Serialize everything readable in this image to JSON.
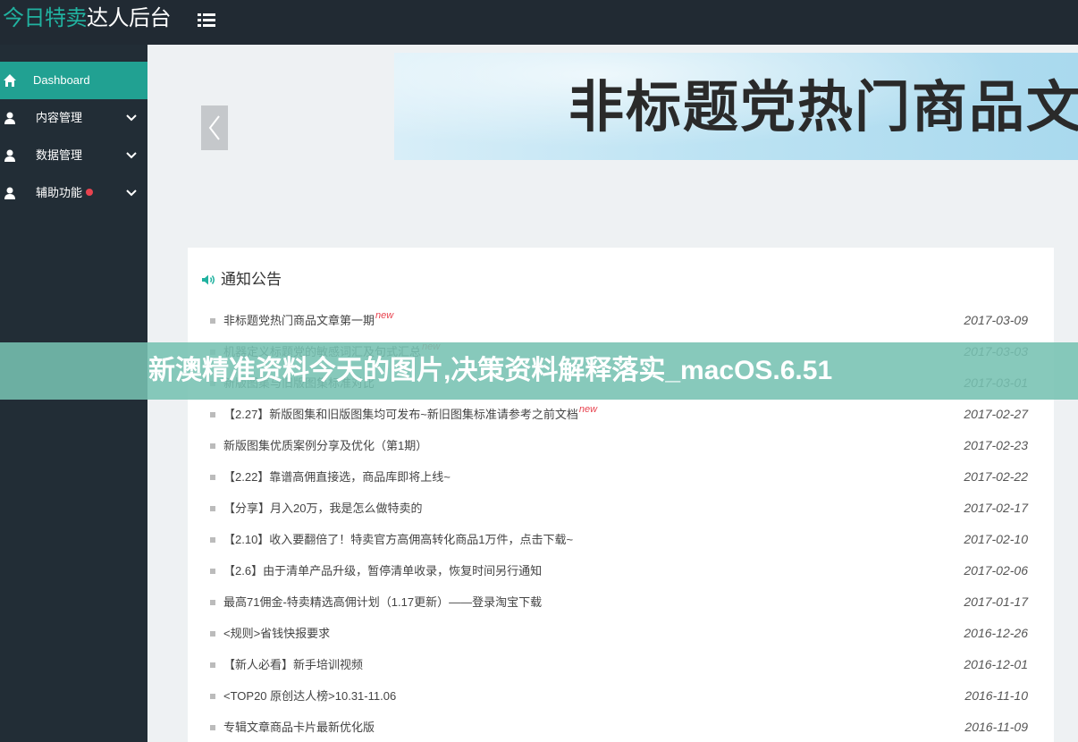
{
  "header": {
    "brand_accent": "今日特卖",
    "brand_main": "达人后台",
    "accent_color": "#21b2a0"
  },
  "sidebar": {
    "items": [
      {
        "label": "Dashboard",
        "icon": "home-icon",
        "active": true
      },
      {
        "label": "内容管理",
        "icon": "user-icon",
        "expandable": true
      },
      {
        "label": "数据管理",
        "icon": "user-icon",
        "expandable": true
      },
      {
        "label": "辅助功能",
        "icon": "user-icon",
        "expandable": true,
        "badge_dot": true
      }
    ]
  },
  "banner": {
    "text": "非标题党热门商品文章第"
  },
  "notices": {
    "title": "通知公告",
    "new_tag": "new",
    "items": [
      {
        "title": "非标题党热门商品文章第一期",
        "date": "2017-03-09",
        "is_new": true
      },
      {
        "title": "机器定义标题党的敏感词汇及句式汇总",
        "date": "2017-03-03",
        "is_new": true
      },
      {
        "title": "新版图集与旧版图集标准对比",
        "date": "2017-03-01",
        "is_new": false
      },
      {
        "title": "【2.27】新版图集和旧版图集均可发布~新旧图集标准请参考之前文档",
        "date": "2017-02-27",
        "is_new": true
      },
      {
        "title": "新版图集优质案例分享及优化（第1期）",
        "date": "2017-02-23",
        "is_new": false
      },
      {
        "title": "【2.22】靠谱高佣直接选，商品库即将上线~",
        "date": "2017-02-22",
        "is_new": false
      },
      {
        "title": "【分享】月入20万，我是怎么做特卖的",
        "date": "2017-02-17",
        "is_new": false
      },
      {
        "title": "【2.10】收入要翻倍了！特卖官方高佣高转化商品1万件，点击下载~",
        "date": "2017-02-10",
        "is_new": false
      },
      {
        "title": "【2.6】由于清单产品升级，暂停清单收录，恢复时间另行通知",
        "date": "2017-02-06",
        "is_new": false
      },
      {
        "title": "最高71佣金-特卖精选高佣计划（1.17更新）——登录淘宝下载",
        "date": "2017-01-17",
        "is_new": false
      },
      {
        "title": "<规则>省钱快报要求",
        "date": "2016-12-26",
        "is_new": false
      },
      {
        "title": "【新人必看】新手培训视频",
        "date": "2016-12-01",
        "is_new": false
      },
      {
        "title": "<TOP20 原创达人榜>10.31-11.06",
        "date": "2016-11-10",
        "is_new": false
      },
      {
        "title": "专辑文章商品卡片最新优化版",
        "date": "2016-11-09",
        "is_new": false
      }
    ]
  },
  "watermark": {
    "text": "新澳精准资料今天的图片,决策资料解释落实_macOS.6.51"
  }
}
